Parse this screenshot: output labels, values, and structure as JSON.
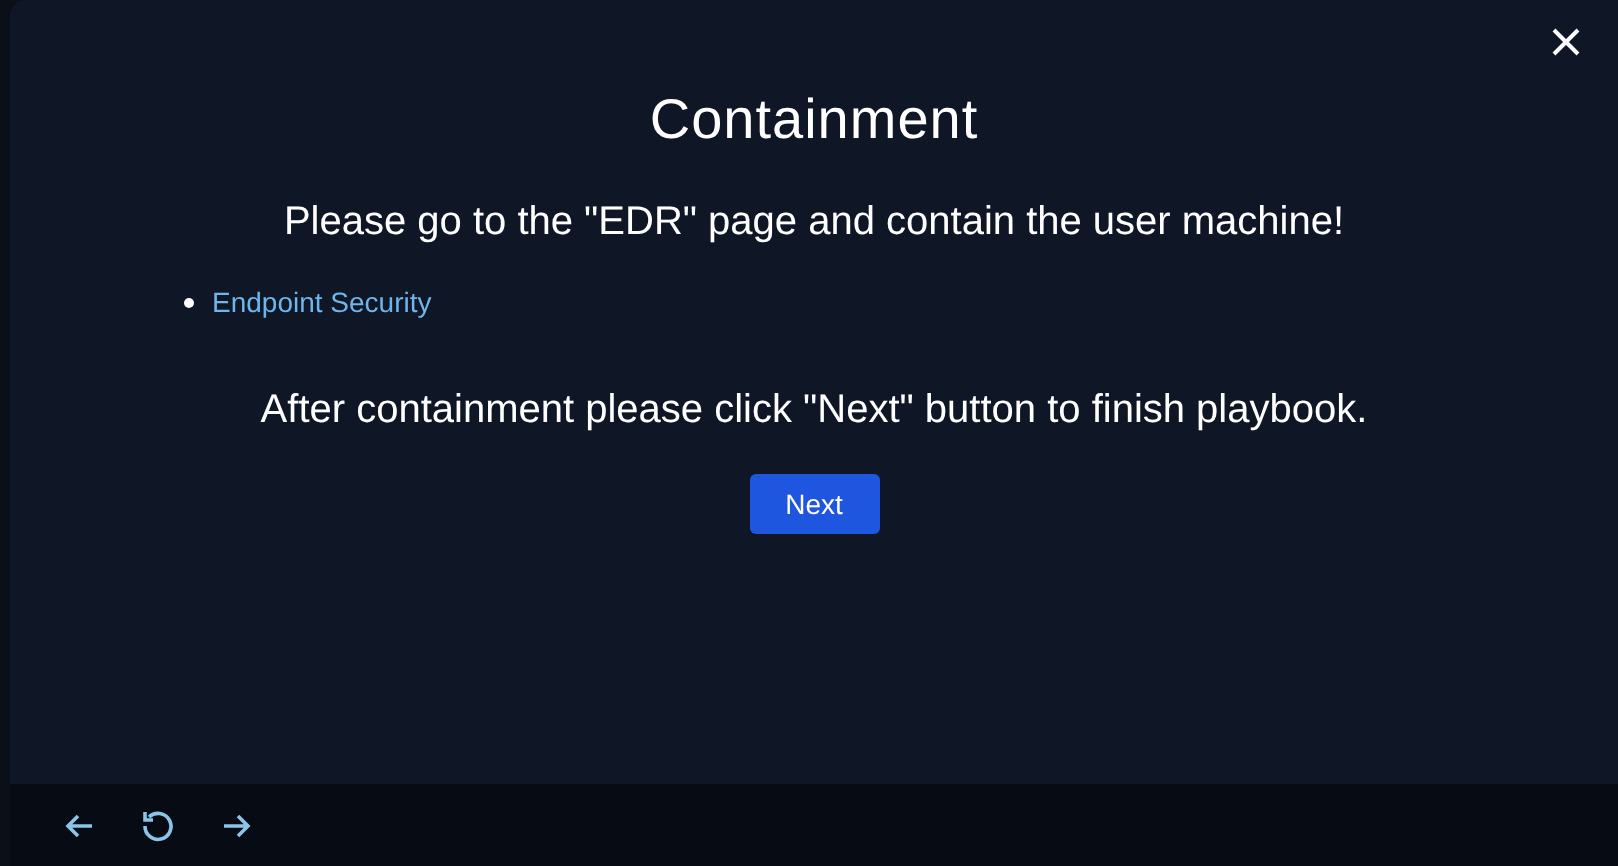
{
  "modal": {
    "title": "Containment",
    "instruction": "Please go to the \"EDR\" page and contain the user machine!",
    "links": [
      "Endpoint Security"
    ],
    "note": "After containment please click \"Next\" button to finish playbook.",
    "primary_button": "Next"
  }
}
